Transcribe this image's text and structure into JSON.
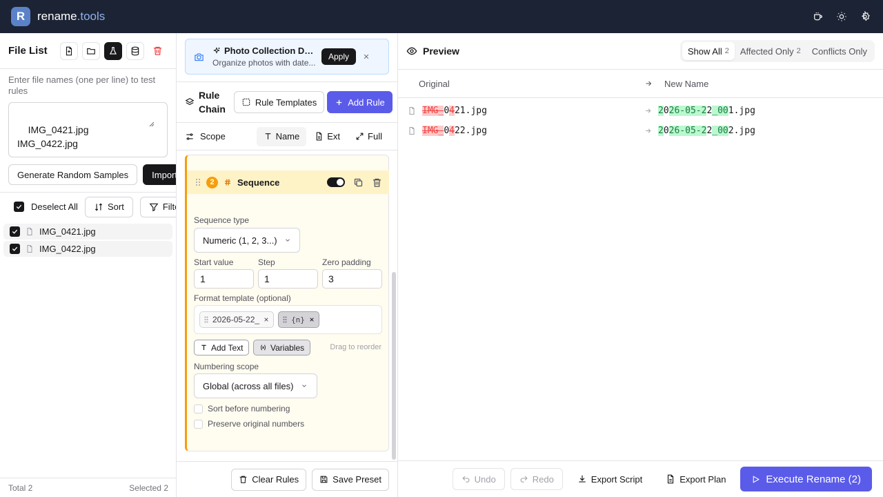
{
  "app": {
    "brand_main": "rename",
    "brand_accent": ".tools",
    "logo_letter": "R"
  },
  "file_list": {
    "title": "File List",
    "hint": "Enter file names (one per line) to test rules",
    "textarea_value": "IMG_0421.jpg\nIMG_0422.jpg",
    "generate_label": "Generate Random Samples",
    "import_label": "Import",
    "deselect_label": "Deselect All",
    "sort_label": "Sort",
    "filter_label": "Filter",
    "files": [
      {
        "name": "IMG_0421.jpg",
        "checked": true
      },
      {
        "name": "IMG_0422.jpg",
        "checked": true
      }
    ],
    "total": "Total 2",
    "selected": "Selected 2"
  },
  "preset": {
    "title": "Photo Collection Det...",
    "subtitle": "Organize photos with date...",
    "apply_label": "Apply"
  },
  "rule_chain": {
    "title": "Rule Chain",
    "templates_label": "Rule Templates",
    "add_rule_label": "Add Rule",
    "scope_label": "Scope",
    "scope_options": [
      "Name",
      "Ext",
      "Full"
    ],
    "active_scope": "Name"
  },
  "rule": {
    "index": "2",
    "name": "Sequence",
    "enabled": true,
    "sequence_type_label": "Sequence type",
    "sequence_type_value": "Numeric (1, 2, 3...)",
    "start_label": "Start value",
    "start_value": "1",
    "step_label": "Step",
    "step_value": "1",
    "padding_label": "Zero padding",
    "padding_value": "3",
    "format_label": "Format template (optional)",
    "chips": [
      "2026-05-22_",
      "{n}"
    ],
    "add_text_label": "Add Text",
    "variables_label": "Variables",
    "drag_hint": "Drag to reorder",
    "scope_label": "Numbering scope",
    "scope_value": "Global (across all files)",
    "sort_before_label": "Sort before numbering",
    "preserve_label": "Preserve original numbers"
  },
  "mid_footer": {
    "clear_label": "Clear Rules",
    "save_label": "Save Preset"
  },
  "preview": {
    "title": "Preview",
    "tabs": [
      {
        "label": "Show All",
        "count": "2"
      },
      {
        "label": "Affected Only",
        "count": "2"
      },
      {
        "label": "Conflicts Only",
        "count": ""
      }
    ],
    "col_original": "Original",
    "col_new": "New Name",
    "rows": [
      {
        "original": [
          {
            "t": "IMG_",
            "k": "del"
          },
          {
            "t": "0",
            "k": ""
          },
          {
            "t": "4",
            "k": "del"
          },
          {
            "t": "21.jpg",
            "k": ""
          }
        ],
        "new": [
          {
            "t": "2",
            "k": "add"
          },
          {
            "t": "0",
            "k": ""
          },
          {
            "t": "26-05-2",
            "k": "add"
          },
          {
            "t": "2",
            "k": ""
          },
          {
            "t": "_00",
            "k": "add"
          },
          {
            "t": "1.jpg",
            "k": ""
          }
        ]
      },
      {
        "original": [
          {
            "t": "IMG_",
            "k": "del"
          },
          {
            "t": "0",
            "k": ""
          },
          {
            "t": "4",
            "k": "del"
          },
          {
            "t": "22.jpg",
            "k": ""
          }
        ],
        "new": [
          {
            "t": "2",
            "k": "add"
          },
          {
            "t": "0",
            "k": ""
          },
          {
            "t": "26-05-2",
            "k": "add"
          },
          {
            "t": "2",
            "k": ""
          },
          {
            "t": "_00",
            "k": "add"
          },
          {
            "t": "2.jpg",
            "k": ""
          }
        ]
      }
    ]
  },
  "right_footer": {
    "undo_label": "Undo",
    "redo_label": "Redo",
    "export_script_label": "Export Script",
    "export_plan_label": "Export Plan",
    "execute_label": "Execute Rename (2)"
  },
  "colors": {
    "accent": "#5b5bea",
    "topbar": "#1c2334",
    "rule_accent": "#f59e0b"
  }
}
